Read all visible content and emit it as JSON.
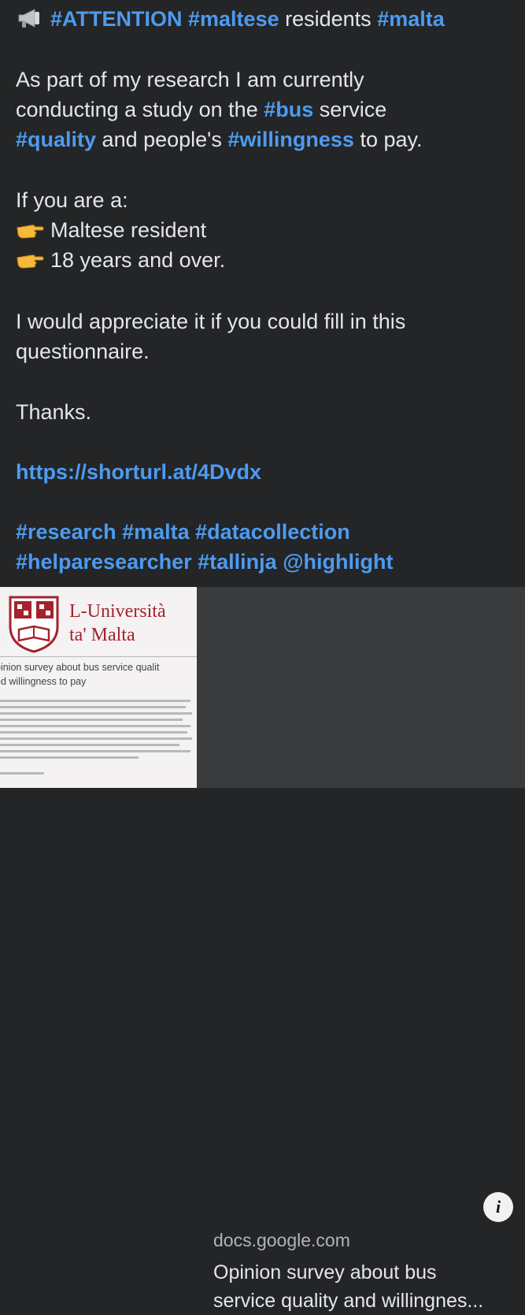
{
  "post": {
    "line1": {
      "emoji": "loudspeaker-icon",
      "tag1": "#ATTENTION",
      "tag2": "#maltese",
      "text": "residents",
      "tag3": "#malta"
    },
    "line2": "As part of my research I am currently",
    "line3": {
      "pre": "conducting a study on the",
      "tag": "#bus",
      "post": "service"
    },
    "line4": {
      "tag1": "#quality",
      "mid": "and people's",
      "tag2": "#willingness",
      "post": "to pay."
    },
    "line5": "If you are a:",
    "bullets": [
      {
        "icon": "pointing-hand-icon",
        "text": "Maltese resident"
      },
      {
        "icon": "pointing-hand-icon",
        "text": "18 years and over."
      }
    ],
    "line8": "I would appreciate it if you could fill in this",
    "line9": "questionnaire.",
    "line10": "Thanks.",
    "link": "https://shorturl.at/4Dvdx",
    "hashtags_line1": "#research #malta #datacollection",
    "hashtags_line2": "#helparesearcher #tallinja @highlight"
  },
  "link_card": {
    "thumbnail": {
      "university_line1": "L-Università",
      "university_line2": "ta' Malta",
      "doc_title_line1": "pinion survey about bus service qualit",
      "doc_title_line2": "ed willingness to pay"
    },
    "info_label": "i",
    "domain": "docs.google.com",
    "title_line1": "Opinion survey about bus",
    "title_line2": "service quality and willingnes..."
  },
  "colors": {
    "background": "#242526",
    "hashtag": "#4d9bf0",
    "card": "#3a3b3c",
    "university_red": "#a5222c"
  }
}
